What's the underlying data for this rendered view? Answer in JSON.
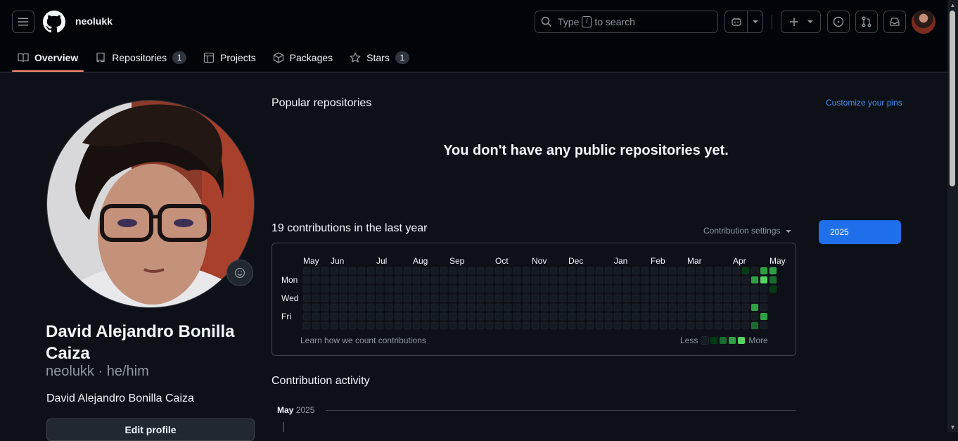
{
  "header": {
    "username": "neolukk",
    "search": {
      "prefix": "Type",
      "key": "/",
      "suffix": "to search"
    }
  },
  "tabs": [
    {
      "label": "Overview",
      "active": true
    },
    {
      "label": "Repositories",
      "count": "1"
    },
    {
      "label": "Projects"
    },
    {
      "label": "Packages"
    },
    {
      "label": "Stars",
      "count": "1"
    }
  ],
  "profile": {
    "fullname": "David Alejandro Bonilla Caiza",
    "handle": "neolukk · he/him",
    "bio": "David Alejandro Bonilla Caiza",
    "edit_label": "Edit profile"
  },
  "popular": {
    "title": "Popular repositories",
    "customize": "Customize your pins",
    "empty": "You don't have any public repositories yet."
  },
  "contributions": {
    "title": "19 contributions in the last year",
    "settings": "Contribution settings",
    "year": "2025",
    "months": [
      "May",
      "Jun",
      "Jul",
      "Aug",
      "Sep",
      "Oct",
      "Nov",
      "Dec",
      "Jan",
      "Feb",
      "Mar",
      "Apr",
      "May"
    ],
    "days": [
      "Mon",
      "Wed",
      "Fri"
    ],
    "learn": "Learn how we count contributions",
    "less": "Less",
    "more": "More",
    "colors": [
      "#151b23",
      "#033a16",
      "#196c2e",
      "#2ea043",
      "#56d364"
    ],
    "active_cells": [
      {
        "week": 48,
        "day": 0,
        "level": 1
      },
      {
        "week": 49,
        "day": 1,
        "level": 3
      },
      {
        "week": 49,
        "day": 4,
        "level": 3
      },
      {
        "week": 49,
        "day": 6,
        "level": 2
      },
      {
        "week": 50,
        "day": 0,
        "level": 3
      },
      {
        "week": 50,
        "day": 1,
        "level": 4
      },
      {
        "week": 50,
        "day": 5,
        "level": 3
      },
      {
        "week": 51,
        "day": 0,
        "level": 3
      },
      {
        "week": 51,
        "day": 1,
        "level": 2
      },
      {
        "week": 51,
        "day": 2,
        "level": 1
      }
    ]
  },
  "activity": {
    "title": "Contribution activity",
    "month": "May",
    "year": "2025"
  }
}
